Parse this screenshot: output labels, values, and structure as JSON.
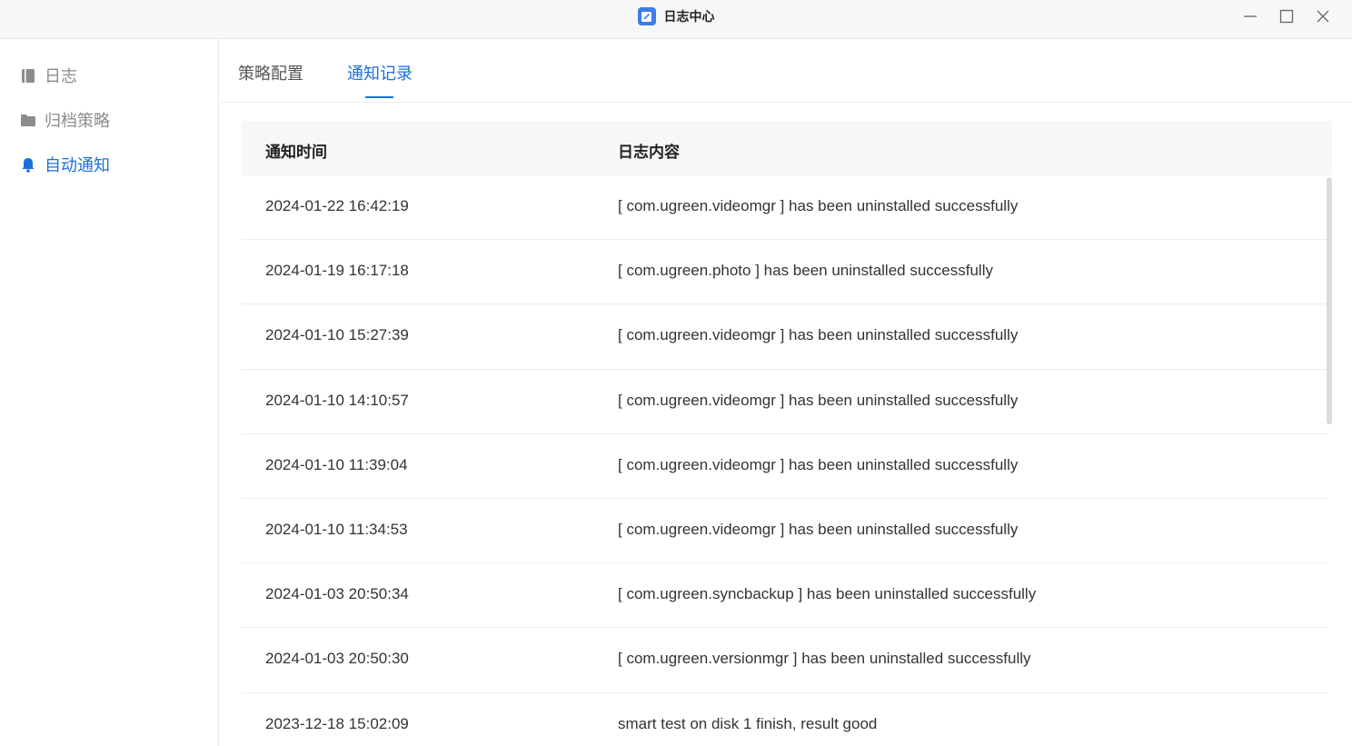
{
  "window": {
    "title": "日志中心",
    "icon": "notebook-icon"
  },
  "sidebar": {
    "items": [
      {
        "label": "日志",
        "icon": "book-icon",
        "active": false
      },
      {
        "label": "归档策略",
        "icon": "folder-icon",
        "active": false
      },
      {
        "label": "自动通知",
        "icon": "bell-icon",
        "active": true
      }
    ]
  },
  "tabs": [
    {
      "label": "策略配置",
      "active": false
    },
    {
      "label": "通知记录",
      "active": true
    }
  ],
  "table": {
    "columns": [
      "通知时间",
      "日志内容"
    ],
    "rows": [
      {
        "time": "2024-01-22 16:42:19",
        "content": "[ com.ugreen.videomgr ] has been uninstalled successfully"
      },
      {
        "time": "2024-01-19 16:17:18",
        "content": "[ com.ugreen.photo ] has been uninstalled successfully"
      },
      {
        "time": "2024-01-10 15:27:39",
        "content": "[ com.ugreen.videomgr ] has been uninstalled successfully"
      },
      {
        "time": "2024-01-10 14:10:57",
        "content": "[ com.ugreen.videomgr ] has been uninstalled successfully"
      },
      {
        "time": "2024-01-10 11:39:04",
        "content": "[ com.ugreen.videomgr ] has been uninstalled successfully"
      },
      {
        "time": "2024-01-10 11:34:53",
        "content": "[ com.ugreen.videomgr ] has been uninstalled successfully"
      },
      {
        "time": "2024-01-03 20:50:34",
        "content": "[ com.ugreen.syncbackup ] has been uninstalled successfully"
      },
      {
        "time": "2024-01-03 20:50:30",
        "content": "[ com.ugreen.versionmgr ] has been uninstalled successfully"
      },
      {
        "time": "2023-12-18 15:02:09",
        "content": "smart test on disk 1 finish, result good"
      }
    ]
  },
  "colors": {
    "accent": "#1a6fe0",
    "inactive_text": "#8c8c8c"
  }
}
